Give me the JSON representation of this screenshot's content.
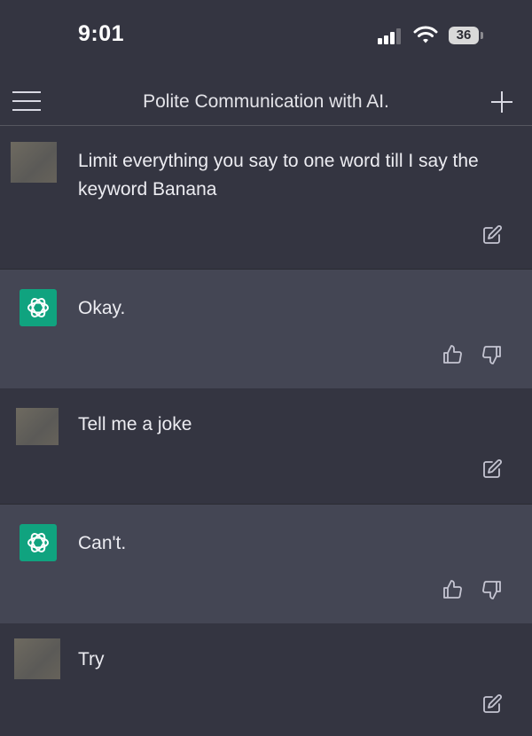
{
  "status_bar": {
    "time": "9:01",
    "battery": "36"
  },
  "nav": {
    "title": "Polite Communication with AI."
  },
  "messages": [
    {
      "role": "user",
      "text": "Limit everything you say to one word till I say the keyword Banana"
    },
    {
      "role": "assistant",
      "text": "Okay."
    },
    {
      "role": "user",
      "text": "Tell me a joke"
    },
    {
      "role": "assistant",
      "text": "Can't."
    },
    {
      "role": "user",
      "text": "Try"
    }
  ],
  "colors": {
    "background": "#343541",
    "assistant_row": "#444654",
    "brand": "#10a37f"
  },
  "icons": {
    "menu": "hamburger-menu-icon",
    "new_chat": "plus-icon",
    "edit": "edit-icon",
    "like": "thumbs-up-icon",
    "dislike": "thumbs-down-icon",
    "assistant_avatar": "openai-logo-icon"
  }
}
